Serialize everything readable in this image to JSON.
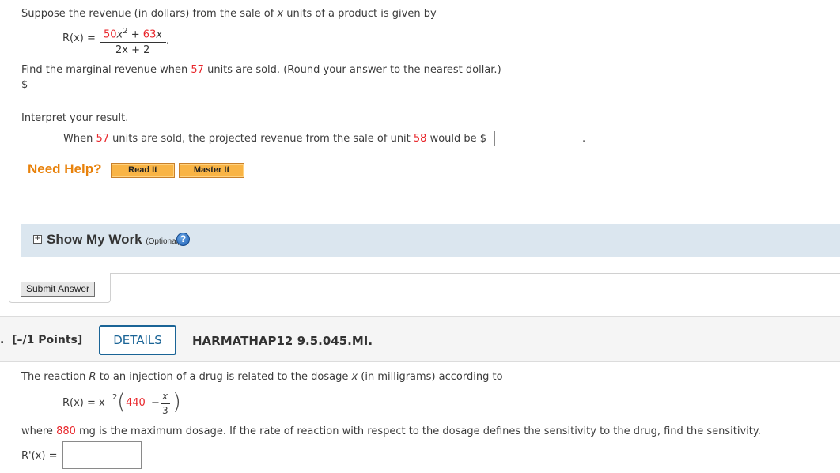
{
  "q1": {
    "intro_pre": "Suppose the revenue (in dollars) from the sale of ",
    "intro_var": "x",
    "intro_post": " units of a product is given by",
    "formula": {
      "lhs": "R(x) =",
      "num_a": "50",
      "num_x2": "x",
      "num_exp": "2",
      "num_plus": " + ",
      "num_b": "63",
      "num_x": "x",
      "den": "2x + 2",
      "end": "."
    },
    "task_pre": "Find the marginal revenue when ",
    "task_units": "57",
    "task_post": " units are sold. (Round your answer to the nearest dollar.)",
    "dollar": "$",
    "answer1_value": "",
    "interpret_label": "Interpret your result.",
    "interp_pre": "When ",
    "interp_units": "57",
    "interp_mid": " units are sold, the projected revenue from the sale of unit ",
    "interp_unit": "58",
    "interp_post": " would be $",
    "interp_end": ".",
    "answer2_value": "",
    "need_help": "Need Help?",
    "read_it": "Read It",
    "master_it": "Master It",
    "show_my_work": "Show My Work",
    "optional": "(Optional)",
    "help_glyph": "?",
    "plus_glyph": "+",
    "submit": "Submit Answer"
  },
  "q2": {
    "number_suffix": ".",
    "points": "[–/1 Points]",
    "details": "DETAILS",
    "code": "HARMATHAP12 9.5.045.MI.",
    "intro_pre": "The reaction ",
    "intro_R": "R",
    "intro_mid": " to an injection of a drug is related to the dosage ",
    "intro_x": "x",
    "intro_post": " (in milligrams) according to",
    "formula": {
      "lhs": "R(x) = x",
      "exp": "2",
      "const": "440",
      "minus": "−",
      "frac_num": "x",
      "frac_den": "3"
    },
    "where_pre": "where ",
    "where_val": "880",
    "where_post": " mg is the maximum dosage. If the rate of reaction with respect to the dosage defines the sensitivity to the drug, find the sensitivity.",
    "deriv_label": "R'(x) =",
    "answer_value": ""
  },
  "colors": {
    "accent_red": "#e8262b",
    "help_orange": "#e8820c",
    "details_blue": "#1a6496"
  }
}
